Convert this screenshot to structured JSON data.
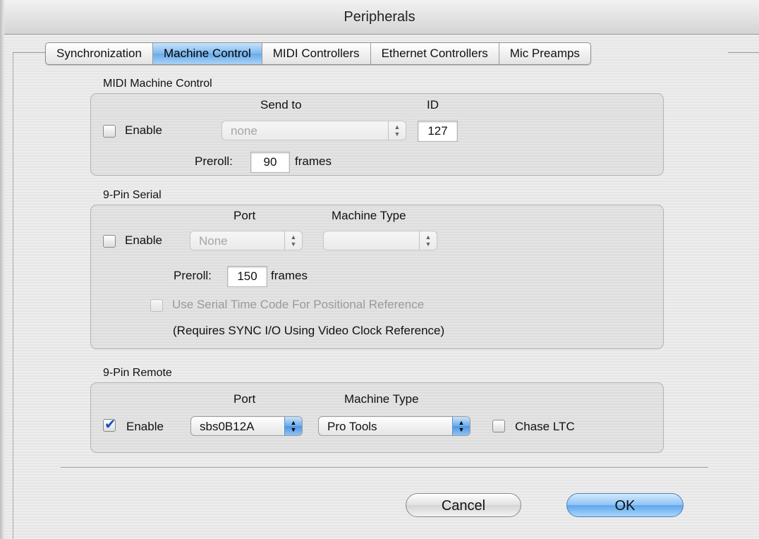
{
  "window": {
    "title": "Peripherals"
  },
  "tabs": [
    {
      "label": "Synchronization",
      "active": false
    },
    {
      "label": "Machine Control",
      "active": true
    },
    {
      "label": "MIDI Controllers",
      "active": false
    },
    {
      "label": "Ethernet Controllers",
      "active": false
    },
    {
      "label": "Mic Preamps",
      "active": false
    }
  ],
  "mmc": {
    "group_label": "MIDI Machine Control",
    "send_to_header": "Send to",
    "id_header": "ID",
    "enable_label": "Enable",
    "enabled": false,
    "send_to_value": "none",
    "id_value": "127",
    "preroll_label": "Preroll:",
    "preroll_value": "90",
    "preroll_units": "frames"
  },
  "serial": {
    "group_label": "9-Pin Serial",
    "port_header": "Port",
    "machine_type_header": "Machine Type",
    "enable_label": "Enable",
    "enabled": false,
    "port_value": "None",
    "machine_type_value": "",
    "preroll_label": "Preroll:",
    "preroll_value": "150",
    "preroll_units": "frames",
    "serial_tc_label": "Use Serial Time Code For Positional Reference",
    "note": "(Requires SYNC I/O Using Video Clock Reference)"
  },
  "remote": {
    "group_label": "9-Pin Remote",
    "port_header": "Port",
    "machine_type_header": "Machine Type",
    "enable_label": "Enable",
    "enabled": true,
    "port_value": "sbs0B12A",
    "machine_type_value": "Pro Tools",
    "chase_ltc_label": "Chase LTC",
    "chase_ltc": false
  },
  "buttons": {
    "cancel": "Cancel",
    "ok": "OK"
  },
  "colors": {
    "accent": "#6aaae8",
    "default_button": "#8dc2f5"
  }
}
